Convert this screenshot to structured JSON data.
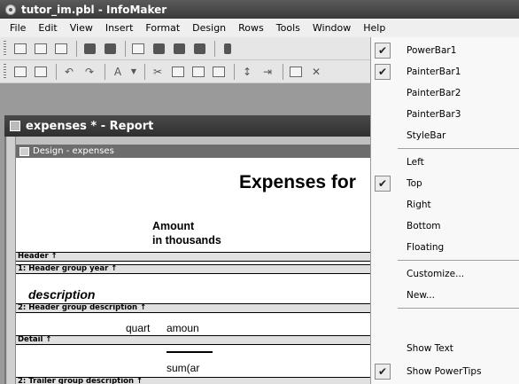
{
  "window": {
    "title": "tutor_im.pbl - InfoMaker"
  },
  "menu": [
    "File",
    "Edit",
    "View",
    "Insert",
    "Format",
    "Design",
    "Rows",
    "Tools",
    "Window",
    "Help"
  ],
  "document": {
    "title": "expenses * - Report"
  },
  "design_panel": {
    "title": "Design - expenses"
  },
  "report": {
    "title": "Expenses for",
    "amount_line1": "Amount",
    "amount_line2": "in thousands",
    "description": "description",
    "quart": "quart",
    "amoun": "amoun",
    "sum": "sum(ar"
  },
  "bands": {
    "header": "Header ↑",
    "group1": "1: Header group year ↑",
    "group2": "2: Header group description ↑",
    "detail": "Detail ↑",
    "trailer2": "2: Trailer group description ↑"
  },
  "context_menu": {
    "items": [
      {
        "label": "PowerBar1",
        "checked": true
      },
      {
        "label": "PainterBar1",
        "checked": true
      },
      {
        "label": "PainterBar2",
        "checked": false
      },
      {
        "label": "PainterBar3",
        "checked": false
      },
      {
        "label": "StyleBar",
        "checked": false
      },
      {
        "label": "Left",
        "checked": false
      },
      {
        "label": "Top",
        "checked": true
      },
      {
        "label": "Right",
        "checked": false
      },
      {
        "label": "Bottom",
        "checked": false
      },
      {
        "label": "Floating",
        "checked": false
      },
      {
        "label": "Customize...",
        "checked": false
      },
      {
        "label": "New...",
        "checked": false
      },
      {
        "label": "Show Text",
        "checked": false
      },
      {
        "label": "Show PowerTips",
        "checked": true
      }
    ],
    "check_glyph": "✔"
  }
}
